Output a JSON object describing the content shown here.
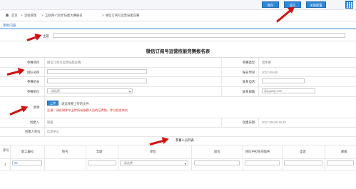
{
  "toolbar": {
    "save_label": "暂存",
    "submit_label": "提交",
    "print_label": "关联配置",
    "menu_icon": "grid-icon"
  },
  "breadcrumb": {
    "items": [
      "首页",
      "流程管理",
      "互联网+“双创”技能大赛报名",
      "微信订阅号运营技能竞赛"
    ]
  },
  "section_tab": "审批内容",
  "subject": {
    "label": "主题",
    "value": ""
  },
  "form": {
    "title": "微信订阅号运营技能竞赛报名表",
    "rows": {
      "project_label": "参赛项目",
      "project_value": "微信订阅号运营技能竞赛",
      "type_label": "参赛类型",
      "type_value": "团体赛",
      "team_label": "团队名称",
      "team_value": "",
      "date_label": "报名时间",
      "date_value": "2017-05-08",
      "leader_label": "参赛组长",
      "leader_value": "",
      "phone_label": "联系电话",
      "phone_value": "",
      "unit_label": "参赛单位",
      "unit_value": "--请选择--",
      "email_label": "联系邮箱",
      "email_value": "@jugang.com",
      "attachment_label": "附件",
      "upload_label": "上传",
      "upload_hint": "请选择要上传的文件",
      "upload_warning": "注意：请在附件中上传所有参赛人员的证件照，并以姓名命名",
      "creator_label": "创建人",
      "creator_value": "韩俊",
      "created_date_label": "创建日期",
      "created_date_value": "2017-05-08 16:25",
      "creator_unit_label": "创建人单位",
      "creator_unit_value": "信息中心"
    }
  },
  "members": {
    "caption": "参赛人员列表",
    "columns": [
      "序号",
      "职工编号",
      "姓名",
      "年龄",
      "单位",
      "岗位",
      "团队中担任的角色",
      "电话",
      "邮箱"
    ],
    "rows": [
      {
        "index": "1",
        "staff_no": "00",
        "unit": "--请选择--"
      }
    ]
  },
  "colors": {
    "accent": "#2f86d6",
    "warning": "#e02020",
    "annotation_arrow": "#d01010"
  }
}
